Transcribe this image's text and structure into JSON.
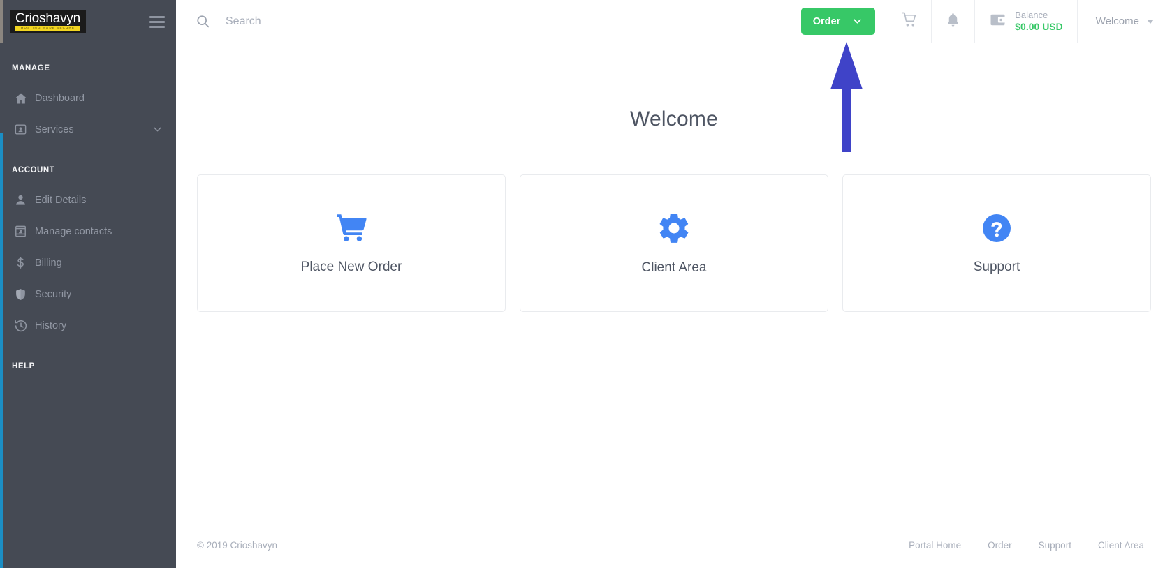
{
  "brand": {
    "logo_name": "Crioshavyn",
    "logo_tagline": "HOSTING MADE SECURE",
    "accent_green": "#37c867",
    "accent_blue": "#4285f4",
    "sidebar_bg": "#454a54",
    "logo_tag_bg": "#f2d521",
    "annotation_arrow_color": "#3f43c8"
  },
  "sidebar": {
    "menu_icon": "hamburger-icon",
    "sections": [
      {
        "label": "MANAGE",
        "items": [
          {
            "label": "Dashboard",
            "icon": "home-icon",
            "has_chevron": false
          },
          {
            "label": "Services",
            "icon": "id-card-icon",
            "has_chevron": true
          }
        ]
      },
      {
        "label": "ACCOUNT",
        "items": [
          {
            "label": "Edit Details",
            "icon": "person-icon",
            "has_chevron": false
          },
          {
            "label": "Manage contacts",
            "icon": "contact-card-icon",
            "has_chevron": false
          },
          {
            "label": "Billing",
            "icon": "dollar-icon",
            "has_chevron": false
          },
          {
            "label": "Security",
            "icon": "shield-icon",
            "has_chevron": false
          },
          {
            "label": "History",
            "icon": "history-clock-icon",
            "has_chevron": false
          }
        ]
      },
      {
        "label": "HELP",
        "items": []
      }
    ]
  },
  "topbar": {
    "search_placeholder": "Search",
    "search_value": "",
    "search_icon": "search-icon",
    "order_button_label": "Order",
    "order_button_icon": "chevron-down-icon",
    "cart_icon": "shopping-cart-icon",
    "bell_icon": "notification-bell-icon",
    "wallet_icon": "wallet-icon",
    "balance_label": "Balance",
    "balance_value": "$0.00 USD",
    "user_label": "Welcome",
    "user_caret": "caret-down-icon"
  },
  "main": {
    "title": "Welcome",
    "cards": [
      {
        "label": "Place New Order",
        "icon": "shopping-cart-icon"
      },
      {
        "label": "Client Area",
        "icon": "gear-icon"
      },
      {
        "label": "Support",
        "icon": "question-mark-circle-icon"
      }
    ]
  },
  "footer": {
    "copyright": "© 2019 Crioshavyn",
    "links": [
      {
        "label": "Portal Home"
      },
      {
        "label": "Order"
      },
      {
        "label": "Support"
      },
      {
        "label": "Client Area"
      }
    ]
  }
}
